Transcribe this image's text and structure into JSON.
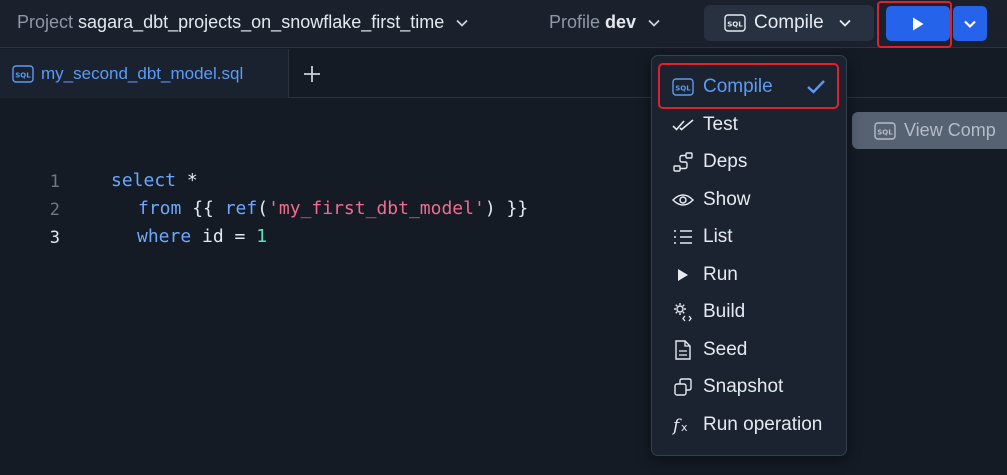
{
  "header": {
    "project_label": "Project",
    "project_name": "sagara_dbt_projects_on_snowflake_first_time",
    "profile_label": "Profile",
    "profile_name": "dev",
    "compile_label": "Compile",
    "sql_badge": "SQL"
  },
  "tabs": [
    {
      "label": "my_second_dbt_model.sql",
      "icon": "sql-file-icon"
    }
  ],
  "editor": {
    "lines": [
      {
        "number": "1",
        "kw1": "select",
        "rest1": " *"
      },
      {
        "number": "2",
        "kw1": "from",
        "p1": " {{ ",
        "kw2": "ref",
        "p2": "(",
        "str": "'my_first_dbt_model'",
        "p3": ") }}"
      },
      {
        "number": "3",
        "kw1": "where",
        "p1": " id = ",
        "num": "1"
      }
    ]
  },
  "view_compiled": {
    "label": "View Comp"
  },
  "run_menu": {
    "items": [
      {
        "label": "Compile",
        "icon": "sql-icon",
        "active": true
      },
      {
        "label": "Test",
        "icon": "double-check-icon"
      },
      {
        "label": "Deps",
        "icon": "deps-icon"
      },
      {
        "label": "Show",
        "icon": "eye-icon"
      },
      {
        "label": "List",
        "icon": "list-icon"
      },
      {
        "label": "Run",
        "icon": "play-icon"
      },
      {
        "label": "Build",
        "icon": "build-gear-icon"
      },
      {
        "label": "Seed",
        "icon": "document-icon"
      },
      {
        "label": "Snapshot",
        "icon": "snapshot-icon"
      },
      {
        "label": "Run operation",
        "icon": "function-icon"
      }
    ]
  },
  "colors": {
    "accent": "#2563eb",
    "highlight": "#e0202e",
    "keyword": "#6ea8fe",
    "string": "#f06d8f",
    "number": "#5ee2b5"
  }
}
